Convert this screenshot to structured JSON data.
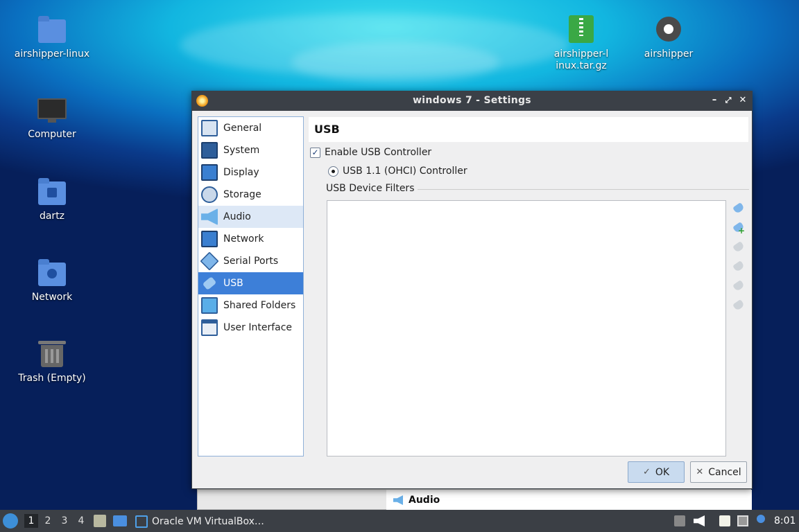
{
  "desktop": {
    "icons": [
      {
        "label": "airshipper-linux",
        "icon": "folder-icon"
      },
      {
        "label": "Computer",
        "icon": "monitor-icon"
      },
      {
        "label": "dartz",
        "icon": "home-folder-icon"
      },
      {
        "label": "Network",
        "icon": "network-folder-icon"
      },
      {
        "label": "Trash (Empty)",
        "icon": "trash-icon"
      },
      {
        "label": "airshipper-linux.tar.gz",
        "icon": "archive-icon"
      },
      {
        "label": "airshipper",
        "icon": "gear-icon"
      }
    ]
  },
  "dialog": {
    "title": "windows 7 - Settings",
    "controls": {
      "minimize": "–",
      "maximize": "⤢",
      "close": "✕"
    },
    "sidebar": {
      "items": [
        {
          "label": "General",
          "icon": "general-icon"
        },
        {
          "label": "System",
          "icon": "system-icon"
        },
        {
          "label": "Display",
          "icon": "display-icon"
        },
        {
          "label": "Storage",
          "icon": "storage-icon"
        },
        {
          "label": "Audio",
          "icon": "audio-icon"
        },
        {
          "label": "Network",
          "icon": "network-icon"
        },
        {
          "label": "Serial Ports",
          "icon": "serial-ports-icon"
        },
        {
          "label": "USB",
          "icon": "usb-icon"
        },
        {
          "label": "Shared Folders",
          "icon": "shared-folders-icon"
        },
        {
          "label": "User Interface",
          "icon": "user-interface-icon"
        }
      ],
      "selected": "USB",
      "hovered": "Audio"
    },
    "page": {
      "heading": "USB",
      "enable_label": "Enable USB Controller",
      "enable_checked": true,
      "controller_label": "USB 1.1 (OHCI) Controller",
      "filters_label": "USB Device Filters",
      "tools": [
        "add-filter-icon",
        "add-from-device-icon",
        "edit-filter-icon",
        "remove-filter-icon",
        "move-up-icon",
        "move-down-icon"
      ]
    },
    "buttons": {
      "ok": "OK",
      "cancel": "Cancel"
    }
  },
  "background_window": {
    "section_label": "Audio"
  },
  "taskbar": {
    "workspaces": [
      "1",
      "2",
      "3",
      "4"
    ],
    "active_workspace": "1",
    "app_label": "Oracle VM VirtualBox…",
    "clock": "8:01"
  },
  "colors": {
    "accent": "#3d7fd8",
    "titlebar": "#3b4047",
    "taskbar": "#3b3f45"
  }
}
